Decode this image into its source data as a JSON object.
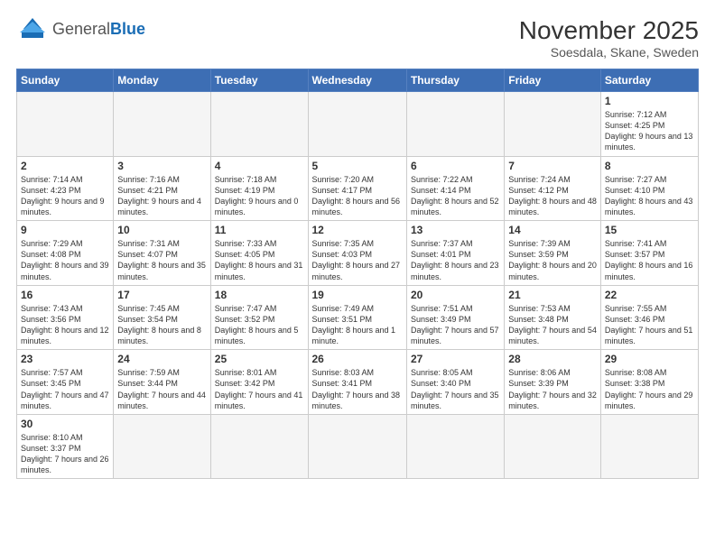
{
  "header": {
    "logo_general": "General",
    "logo_blue": "Blue",
    "month_year": "November 2025",
    "location": "Soesdala, Skane, Sweden"
  },
  "weekdays": [
    "Sunday",
    "Monday",
    "Tuesday",
    "Wednesday",
    "Thursday",
    "Friday",
    "Saturday"
  ],
  "days": [
    {
      "num": "",
      "info": ""
    },
    {
      "num": "",
      "info": ""
    },
    {
      "num": "",
      "info": ""
    },
    {
      "num": "",
      "info": ""
    },
    {
      "num": "",
      "info": ""
    },
    {
      "num": "",
      "info": ""
    },
    {
      "num": "1",
      "info": "Sunrise: 7:12 AM\nSunset: 4:25 PM\nDaylight: 9 hours and 13 minutes."
    },
    {
      "num": "2",
      "info": "Sunrise: 7:14 AM\nSunset: 4:23 PM\nDaylight: 9 hours and 9 minutes."
    },
    {
      "num": "3",
      "info": "Sunrise: 7:16 AM\nSunset: 4:21 PM\nDaylight: 9 hours and 4 minutes."
    },
    {
      "num": "4",
      "info": "Sunrise: 7:18 AM\nSunset: 4:19 PM\nDaylight: 9 hours and 0 minutes."
    },
    {
      "num": "5",
      "info": "Sunrise: 7:20 AM\nSunset: 4:17 PM\nDaylight: 8 hours and 56 minutes."
    },
    {
      "num": "6",
      "info": "Sunrise: 7:22 AM\nSunset: 4:14 PM\nDaylight: 8 hours and 52 minutes."
    },
    {
      "num": "7",
      "info": "Sunrise: 7:24 AM\nSunset: 4:12 PM\nDaylight: 8 hours and 48 minutes."
    },
    {
      "num": "8",
      "info": "Sunrise: 7:27 AM\nSunset: 4:10 PM\nDaylight: 8 hours and 43 minutes."
    },
    {
      "num": "9",
      "info": "Sunrise: 7:29 AM\nSunset: 4:08 PM\nDaylight: 8 hours and 39 minutes."
    },
    {
      "num": "10",
      "info": "Sunrise: 7:31 AM\nSunset: 4:07 PM\nDaylight: 8 hours and 35 minutes."
    },
    {
      "num": "11",
      "info": "Sunrise: 7:33 AM\nSunset: 4:05 PM\nDaylight: 8 hours and 31 minutes."
    },
    {
      "num": "12",
      "info": "Sunrise: 7:35 AM\nSunset: 4:03 PM\nDaylight: 8 hours and 27 minutes."
    },
    {
      "num": "13",
      "info": "Sunrise: 7:37 AM\nSunset: 4:01 PM\nDaylight: 8 hours and 23 minutes."
    },
    {
      "num": "14",
      "info": "Sunrise: 7:39 AM\nSunset: 3:59 PM\nDaylight: 8 hours and 20 minutes."
    },
    {
      "num": "15",
      "info": "Sunrise: 7:41 AM\nSunset: 3:57 PM\nDaylight: 8 hours and 16 minutes."
    },
    {
      "num": "16",
      "info": "Sunrise: 7:43 AM\nSunset: 3:56 PM\nDaylight: 8 hours and 12 minutes."
    },
    {
      "num": "17",
      "info": "Sunrise: 7:45 AM\nSunset: 3:54 PM\nDaylight: 8 hours and 8 minutes."
    },
    {
      "num": "18",
      "info": "Sunrise: 7:47 AM\nSunset: 3:52 PM\nDaylight: 8 hours and 5 minutes."
    },
    {
      "num": "19",
      "info": "Sunrise: 7:49 AM\nSunset: 3:51 PM\nDaylight: 8 hours and 1 minute."
    },
    {
      "num": "20",
      "info": "Sunrise: 7:51 AM\nSunset: 3:49 PM\nDaylight: 7 hours and 57 minutes."
    },
    {
      "num": "21",
      "info": "Sunrise: 7:53 AM\nSunset: 3:48 PM\nDaylight: 7 hours and 54 minutes."
    },
    {
      "num": "22",
      "info": "Sunrise: 7:55 AM\nSunset: 3:46 PM\nDaylight: 7 hours and 51 minutes."
    },
    {
      "num": "23",
      "info": "Sunrise: 7:57 AM\nSunset: 3:45 PM\nDaylight: 7 hours and 47 minutes."
    },
    {
      "num": "24",
      "info": "Sunrise: 7:59 AM\nSunset: 3:44 PM\nDaylight: 7 hours and 44 minutes."
    },
    {
      "num": "25",
      "info": "Sunrise: 8:01 AM\nSunset: 3:42 PM\nDaylight: 7 hours and 41 minutes."
    },
    {
      "num": "26",
      "info": "Sunrise: 8:03 AM\nSunset: 3:41 PM\nDaylight: 7 hours and 38 minutes."
    },
    {
      "num": "27",
      "info": "Sunrise: 8:05 AM\nSunset: 3:40 PM\nDaylight: 7 hours and 35 minutes."
    },
    {
      "num": "28",
      "info": "Sunrise: 8:06 AM\nSunset: 3:39 PM\nDaylight: 7 hours and 32 minutes."
    },
    {
      "num": "29",
      "info": "Sunrise: 8:08 AM\nSunset: 3:38 PM\nDaylight: 7 hours and 29 minutes."
    },
    {
      "num": "30",
      "info": "Sunrise: 8:10 AM\nSunset: 3:37 PM\nDaylight: 7 hours and 26 minutes."
    },
    {
      "num": "",
      "info": ""
    },
    {
      "num": "",
      "info": ""
    },
    {
      "num": "",
      "info": ""
    },
    {
      "num": "",
      "info": ""
    },
    {
      "num": "",
      "info": ""
    },
    {
      "num": "",
      "info": ""
    }
  ]
}
